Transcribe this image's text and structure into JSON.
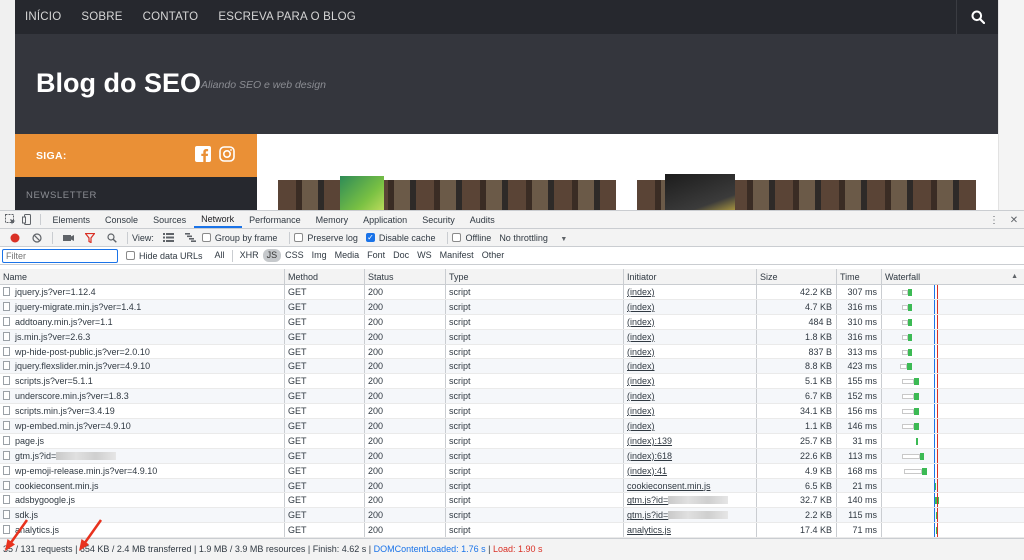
{
  "site": {
    "nav": [
      "INÍCIO",
      "SOBRE",
      "CONTATO",
      "ESCREVA PARA O BLOG"
    ],
    "title": "Blog do SEO",
    "tagline": "Aliando SEO e web design",
    "siga_label": "SIGA:",
    "newsletter_label": "NEWSLETTER"
  },
  "devtools": {
    "tabs": [
      "Elements",
      "Console",
      "Sources",
      "Network",
      "Performance",
      "Memory",
      "Application",
      "Security",
      "Audits"
    ],
    "active_tab": "Network",
    "toolbar": {
      "view_label": "View:",
      "group_by_frame": "Group by frame",
      "preserve_log": "Preserve log",
      "disable_cache": "Disable cache",
      "offline": "Offline",
      "throttling": "No throttling"
    },
    "filter": {
      "placeholder": "Filter",
      "hide_data_urls": "Hide data URLs",
      "types": [
        "All",
        "XHR",
        "JS",
        "CSS",
        "Img",
        "Media",
        "Font",
        "Doc",
        "WS",
        "Manifest",
        "Other"
      ],
      "active_type": "JS"
    },
    "columns": [
      "Name",
      "Method",
      "Status",
      "Type",
      "Initiator",
      "Size",
      "Time",
      "Waterfall"
    ],
    "rows": [
      {
        "name": "jquery.js?ver=1.12.4",
        "method": "GET",
        "status": "200",
        "type": "script",
        "initiator": "(index)",
        "size": "42.2 KB",
        "time": "307 ms"
      },
      {
        "name": "jquery-migrate.min.js?ver=1.4.1",
        "method": "GET",
        "status": "200",
        "type": "script",
        "initiator": "(index)",
        "size": "4.7 KB",
        "time": "316 ms"
      },
      {
        "name": "addtoany.min.js?ver=1.1",
        "method": "GET",
        "status": "200",
        "type": "script",
        "initiator": "(index)",
        "size": "484 B",
        "time": "310 ms"
      },
      {
        "name": "js.min.js?ver=2.6.3",
        "method": "GET",
        "status": "200",
        "type": "script",
        "initiator": "(index)",
        "size": "1.8 KB",
        "time": "316 ms"
      },
      {
        "name": "wp-hide-post-public.js?ver=2.0.10",
        "method": "GET",
        "status": "200",
        "type": "script",
        "initiator": "(index)",
        "size": "837 B",
        "time": "313 ms"
      },
      {
        "name": "jquery.flexslider.min.js?ver=4.9.10",
        "method": "GET",
        "status": "200",
        "type": "script",
        "initiator": "(index)",
        "size": "8.8 KB",
        "time": "423 ms"
      },
      {
        "name": "scripts.js?ver=5.1.1",
        "method": "GET",
        "status": "200",
        "type": "script",
        "initiator": "(index)",
        "size": "5.1 KB",
        "time": "155 ms"
      },
      {
        "name": "underscore.min.js?ver=1.8.3",
        "method": "GET",
        "status": "200",
        "type": "script",
        "initiator": "(index)",
        "size": "6.7 KB",
        "time": "152 ms"
      },
      {
        "name": "scripts.min.js?ver=3.4.19",
        "method": "GET",
        "status": "200",
        "type": "script",
        "initiator": "(index)",
        "size": "34.1 KB",
        "time": "156 ms"
      },
      {
        "name": "wp-embed.min.js?ver=4.9.10",
        "method": "GET",
        "status": "200",
        "type": "script",
        "initiator": "(index)",
        "size": "1.1 KB",
        "time": "146 ms"
      },
      {
        "name": "page.js",
        "method": "GET",
        "status": "200",
        "type": "script",
        "initiator": "(index):139",
        "size": "25.7 KB",
        "time": "31 ms"
      },
      {
        "name": "gtm.js?id=",
        "method": "GET",
        "status": "200",
        "type": "script",
        "initiator": "(index):618",
        "size": "22.6 KB",
        "time": "113 ms"
      },
      {
        "name": "wp-emoji-release.min.js?ver=4.9.10",
        "method": "GET",
        "status": "200",
        "type": "script",
        "initiator": "(index):41",
        "size": "4.9 KB",
        "time": "168 ms"
      },
      {
        "name": "cookieconsent.min.js",
        "method": "GET",
        "status": "200",
        "type": "script",
        "initiator": "cookieconsent.min.js",
        "size": "6.5 KB",
        "time": "21 ms"
      },
      {
        "name": "adsbygoogle.js",
        "method": "GET",
        "status": "200",
        "type": "script",
        "initiator": "gtm.js?id=",
        "size": "32.7 KB",
        "time": "140 ms"
      },
      {
        "name": "sdk.js",
        "method": "GET",
        "status": "200",
        "type": "script",
        "initiator": "gtm.js?id=",
        "size": "2.2 KB",
        "time": "115 ms"
      },
      {
        "name": "analytics.js",
        "method": "GET",
        "status": "200",
        "type": "script",
        "initiator": "analytics.js",
        "size": "17.4 KB",
        "time": "71 ms"
      }
    ],
    "status": {
      "requests": "35 / 131 requests",
      "transferred": "654 KB / 2.4 MB transferred",
      "resources": "1.9 MB / 3.9 MB resources",
      "finish": "Finish: 4.62 s",
      "dcl": "DOMContentLoaded: 1.76 s",
      "load": "Load: 1.90 s"
    }
  },
  "colors": {
    "accent": "#1a73e8",
    "orange": "#ea9036",
    "red_arrow": "#e8321e",
    "waterfall_green": "#3cba54"
  }
}
